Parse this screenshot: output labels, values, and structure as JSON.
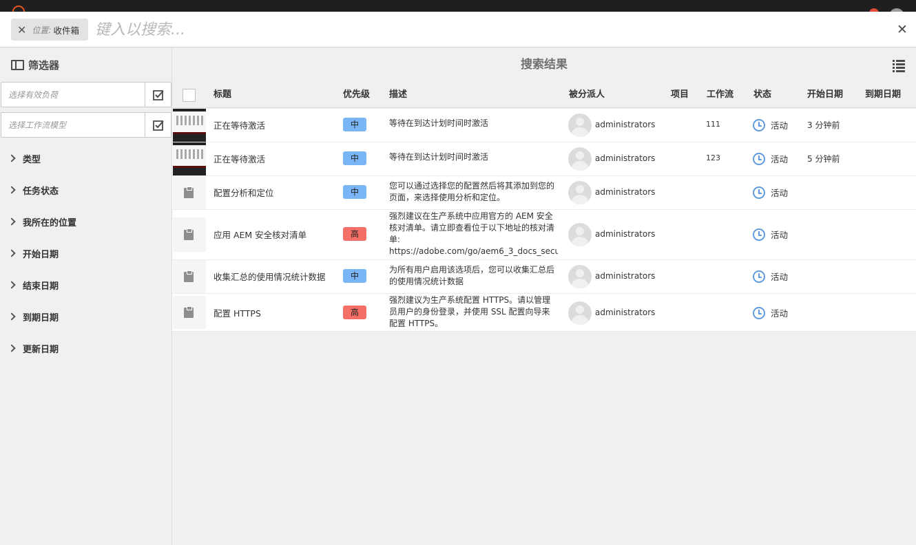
{
  "search": {
    "location_label": "位置:",
    "location_value": "收件箱",
    "placeholder": "键入以搜索..."
  },
  "sidebar": {
    "title": "筛选器",
    "picker1_placeholder": "选择有效负荷",
    "picker2_placeholder": "选择工作流模型",
    "facets": [
      "类型",
      "任务状态",
      "我所在的位置",
      "开始日期",
      "结束日期",
      "到期日期",
      "更新日期"
    ]
  },
  "main": {
    "title": "搜索结果",
    "columns": [
      "标题",
      "优先级",
      "描述",
      "被分派人",
      "项目",
      "工作流",
      "状态",
      "开始日期",
      "到期日期"
    ]
  },
  "rows": [
    {
      "thumb": "image",
      "title": "正在等待激活",
      "priority": "中",
      "priority_level": "medium",
      "desc": "等待在到达计划时间时激活",
      "assignee": "administrators",
      "project": "",
      "workflow": "111",
      "status": "活动",
      "start": "3 分钟前",
      "due": ""
    },
    {
      "thumb": "image",
      "title": "正在等待激活",
      "priority": "中",
      "priority_level": "medium",
      "desc": "等待在到达计划时间时激活",
      "assignee": "administrators",
      "project": "",
      "workflow": "123",
      "status": "活动",
      "start": "5 分钟前",
      "due": ""
    },
    {
      "thumb": "clipboard",
      "title": "配置分析和定位",
      "priority": "中",
      "priority_level": "medium",
      "desc": "您可以通过选择您的配置然后将其添加到您的页面，来选择使用分析和定位。",
      "assignee": "administrators",
      "project": "",
      "workflow": "",
      "status": "活动",
      "start": "",
      "due": ""
    },
    {
      "thumb": "clipboard",
      "title": "应用 AEM 安全核对清单",
      "priority": "高",
      "priority_level": "high",
      "desc": "强烈建议在生产系统中应用官方的 AEM 安全核对清单。请立即查看位于以下地址的核对清单: https://adobe.com/go/aem6_3_docs_secu...",
      "assignee": "administrators",
      "project": "",
      "workflow": "",
      "status": "活动",
      "start": "",
      "due": ""
    },
    {
      "thumb": "clipboard",
      "title": "收集汇总的使用情况统计数据",
      "priority": "中",
      "priority_level": "medium",
      "desc": "为所有用户启用该选项后，您可以收集汇总后的使用情况统计数据",
      "assignee": "administrators",
      "project": "",
      "workflow": "",
      "status": "活动",
      "start": "",
      "due": ""
    },
    {
      "thumb": "clipboard",
      "title": "配置 HTTPS",
      "priority": "高",
      "priority_level": "high",
      "desc": "强烈建议为生产系统配置 HTTPS。请以管理员用户的身份登录，并使用 SSL 配置向导来配置 HTTPS。",
      "assignee": "administrators",
      "project": "",
      "workflow": "",
      "status": "活动",
      "start": "",
      "due": ""
    }
  ],
  "colors": {
    "priority_medium": "#7ab5f5",
    "priority_high": "#f36f67",
    "status_icon": "#5e9be0"
  }
}
